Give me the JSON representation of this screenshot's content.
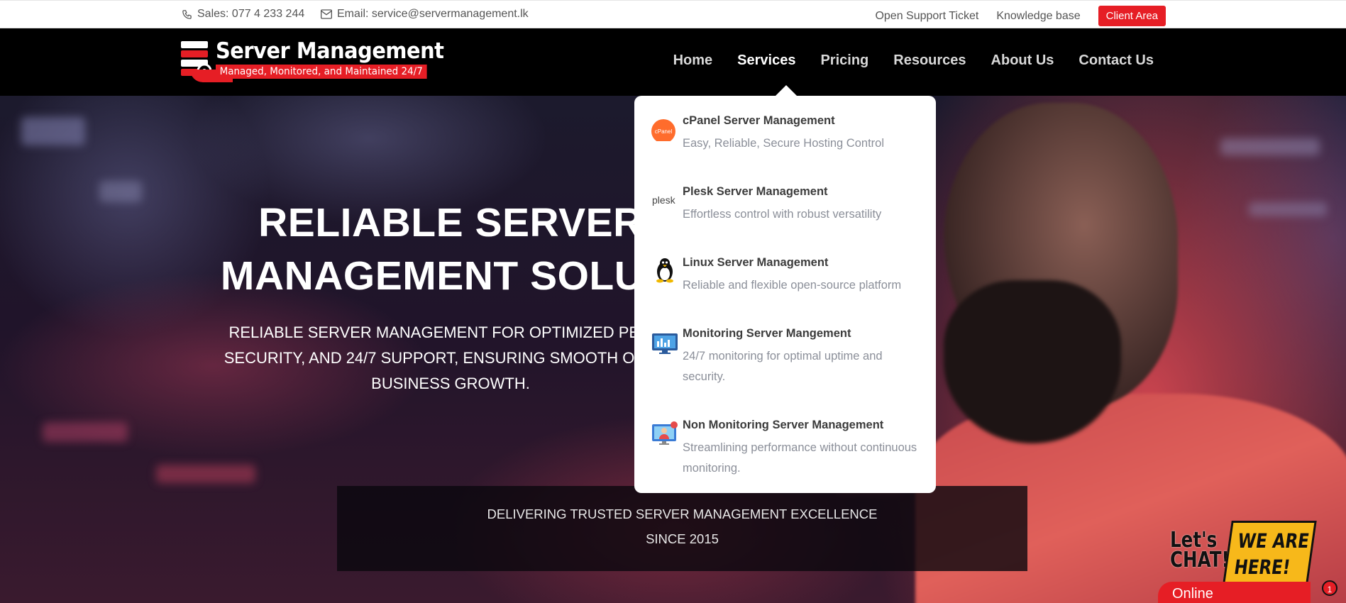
{
  "topbar": {
    "sales": "Sales: 077 4 233 244",
    "email": "Email: service@servermanagement.lk",
    "links": [
      "Open Support Ticket",
      "Knowledge base"
    ],
    "client_area": "Client Area"
  },
  "logo": {
    "title": "Server Management",
    "tagline": "Managed, Monitored, and Maintained 24/7"
  },
  "nav": [
    "Home",
    "Services",
    "Pricing",
    "Resources",
    "About Us",
    "Contact Us"
  ],
  "nav_active": "Services",
  "dropdown": [
    {
      "icon": "cpanel-icon",
      "logo_text": "cPanel",
      "title": "cPanel Server Management",
      "desc": "Easy, Reliable, Secure Hosting Control"
    },
    {
      "icon": "plesk-icon",
      "logo_text": "plesk",
      "title": "Plesk Server Management",
      "desc": "Effortless control with robust versatility"
    },
    {
      "icon": "linux-tux-icon",
      "title": "Linux Server Management",
      "desc": "Reliable and flexible open-source platform"
    },
    {
      "icon": "monitor-chart-icon",
      "title": "Monitoring Server Mangement",
      "desc": "24/7 monitoring for optimal uptime and security."
    },
    {
      "icon": "screen-user-icon",
      "title": "Non Monitoring Server Management",
      "desc": "Streamlining performance without continuous monitoring."
    }
  ],
  "hero": {
    "title_line1": "RELIABLE SERVER",
    "title_line2": "MANAGEMENT SOLUTI",
    "sub_line1": "RELIABLE SERVER MANAGEMENT FOR OPTIMIZED PERFO",
    "sub_line2": "SECURITY, AND 24/7 SUPPORT, ENSURING SMOOTH OPERA",
    "sub_line3": "BUSINESS GROWTH.",
    "band_line1": "DELIVERING TRUSTED SERVER MANAGEMENT EXCELLENCE",
    "band_line2": "SINCE 2015"
  },
  "chat": {
    "lets1": "Let's",
    "lets2": "CHAT!",
    "we1": "WE ARE",
    "we2": "HERE!",
    "online": "Online",
    "badge": "1"
  },
  "colors": {
    "brand_red": "#e61e25",
    "chat_yellow": "#f7b81a",
    "cpanel_orange": "#ff6c2c"
  }
}
